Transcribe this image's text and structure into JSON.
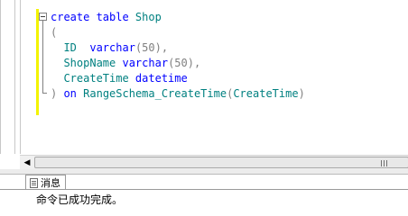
{
  "editor": {
    "lines": [
      [
        {
          "t": "create table ",
          "c": "kw"
        },
        {
          "t": "Shop",
          "c": "ident"
        }
      ],
      [
        {
          "t": "(",
          "c": "punct"
        }
      ],
      [
        {
          "t": "  ID  ",
          "c": "ident"
        },
        {
          "t": "varchar",
          "c": "kw"
        },
        {
          "t": "(50),",
          "c": "punct"
        }
      ],
      [
        {
          "t": "  ShopName ",
          "c": "ident"
        },
        {
          "t": "varchar",
          "c": "kw"
        },
        {
          "t": "(50),",
          "c": "punct"
        }
      ],
      [
        {
          "t": "  CreateTime ",
          "c": "ident"
        },
        {
          "t": "datetime",
          "c": "kw"
        }
      ],
      [
        {
          "t": ") ",
          "c": "punct"
        },
        {
          "t": "on ",
          "c": "kw"
        },
        {
          "t": "RangeSchema_CreateTime",
          "c": "ident"
        },
        {
          "t": "(",
          "c": "punct"
        },
        {
          "t": "CreateTime",
          "c": "ident"
        },
        {
          "t": ")",
          "c": "punct"
        }
      ]
    ],
    "colors": {
      "keyword": "#0000ff",
      "identifier": "#008080",
      "punctuation": "#808080",
      "change_bar": "#f3f300"
    }
  },
  "scrollbar": {
    "left_arrow_icon": "triangle-left-icon",
    "grip_icon": "grip-icon"
  },
  "results": {
    "tabs": [
      {
        "label": "消息",
        "icon": "messages-icon"
      }
    ],
    "message": "命令已成功完成。"
  }
}
